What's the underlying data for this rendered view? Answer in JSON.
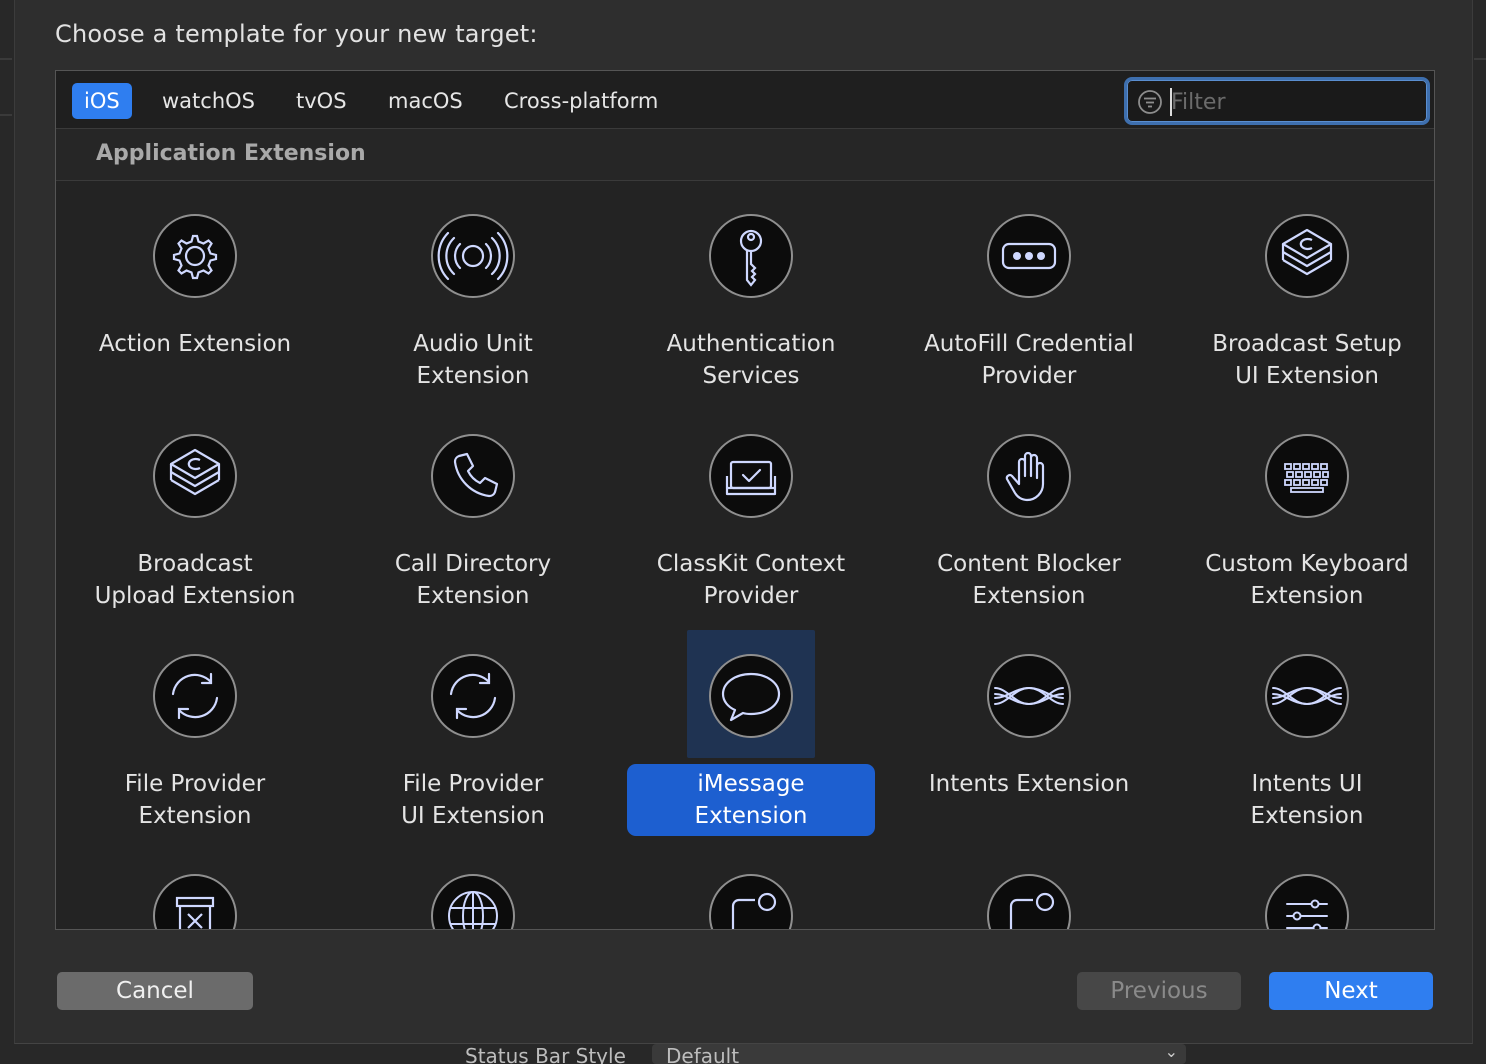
{
  "dialog": {
    "prompt": "Choose a template for your new target:"
  },
  "platform_tabs": [
    {
      "label": "iOS",
      "active": true
    },
    {
      "label": "watchOS",
      "active": false
    },
    {
      "label": "tvOS",
      "active": false
    },
    {
      "label": "macOS",
      "active": false
    },
    {
      "label": "Cross-platform",
      "active": false
    }
  ],
  "filter": {
    "placeholder": "Filter",
    "value": "",
    "icon": "filter-icon"
  },
  "section_title": "Application Extension",
  "templates": [
    {
      "label": "Action Extension",
      "icon": "gear-icon"
    },
    {
      "label": "Audio Unit\nExtension",
      "icon": "audio-waves-icon"
    },
    {
      "label": "Authentication\nServices",
      "icon": "key-icon"
    },
    {
      "label": "AutoFill Credential\nProvider",
      "icon": "password-dots-icon"
    },
    {
      "label": "Broadcast Setup\nUI Extension",
      "icon": "broadcast-stack-icon"
    },
    {
      "label": "Broadcast\nUpload Extension",
      "icon": "broadcast-stack-icon"
    },
    {
      "label": "Call Directory\nExtension",
      "icon": "phone-icon"
    },
    {
      "label": "ClassKit Context\nProvider",
      "icon": "classkit-icon"
    },
    {
      "label": "Content Blocker\nExtension",
      "icon": "hand-icon"
    },
    {
      "label": "Custom Keyboard\nExtension",
      "icon": "keyboard-icon"
    },
    {
      "label": "File Provider\nExtension",
      "icon": "sync-arrows-icon"
    },
    {
      "label": "File Provider\nUI Extension",
      "icon": "sync-arrows-icon"
    },
    {
      "label": "iMessage\nExtension",
      "icon": "speech-bubble-icon",
      "selected": true
    },
    {
      "label": "Intents Extension",
      "icon": "intents-waves-icon"
    },
    {
      "label": "Intents UI\nExtension",
      "icon": "intents-waves-icon"
    },
    {
      "label": "",
      "icon": "trash-box-icon"
    },
    {
      "label": "",
      "icon": "globe-icon"
    },
    {
      "label": "",
      "icon": "notification-icon"
    },
    {
      "label": "",
      "icon": "notification-icon"
    },
    {
      "label": "",
      "icon": "sliders-icon"
    }
  ],
  "buttons": {
    "cancel": "Cancel",
    "previous": "Previous",
    "next": "Next"
  },
  "background_window": {
    "label": "Status Bar Style",
    "popup_value": "Default"
  },
  "colors": {
    "accent": "#2f7ef0",
    "selection_label": "#1d5fd0",
    "selection_tile": "#1f3352"
  }
}
